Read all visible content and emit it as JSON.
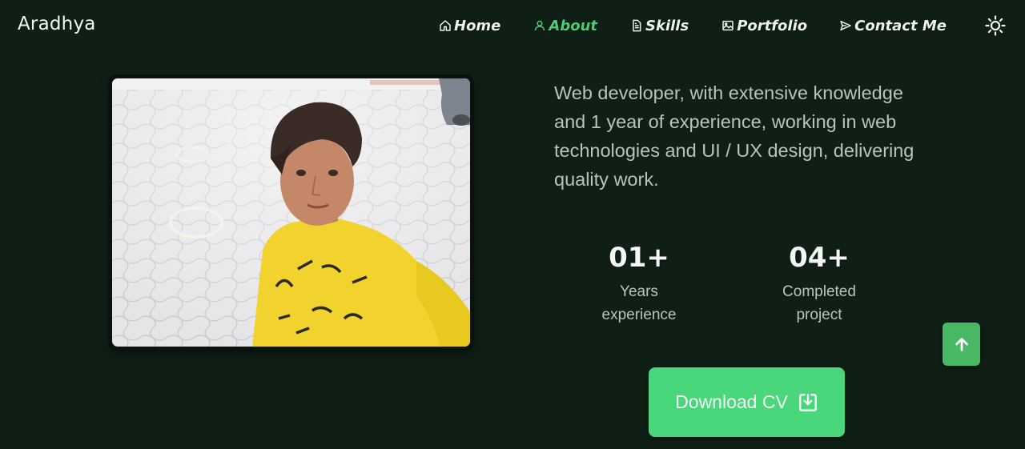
{
  "header": {
    "logo": "Aradhya",
    "nav": [
      {
        "label": "Home",
        "icon": "home-icon",
        "active": false
      },
      {
        "label": "About",
        "icon": "user-icon",
        "active": true
      },
      {
        "label": "Skills",
        "icon": "document-icon",
        "active": false
      },
      {
        "label": "Portfolio",
        "icon": "image-icon",
        "active": false
      },
      {
        "label": "Contact Me",
        "icon": "send-icon",
        "active": false
      }
    ],
    "theme_icon": "sun-icon"
  },
  "about": {
    "photo_alt": "profile-photo",
    "bio": "Web developer, with extensive knowledge and 1 year of experience, working in web technologies and UI / UX design, delivering quality work.",
    "stats": [
      {
        "value": "01+",
        "label_line1": "Years",
        "label_line2": "experience"
      },
      {
        "value": "04+",
        "label_line1": "Completed",
        "label_line2": "project"
      }
    ],
    "download_label": "Download CV",
    "download_icon": "download-icon"
  },
  "scroll_up_icon": "arrow-up-icon",
  "colors": {
    "background": "#0f1f16",
    "accent": "#4ad67a",
    "active_nav": "#4ccf74"
  }
}
